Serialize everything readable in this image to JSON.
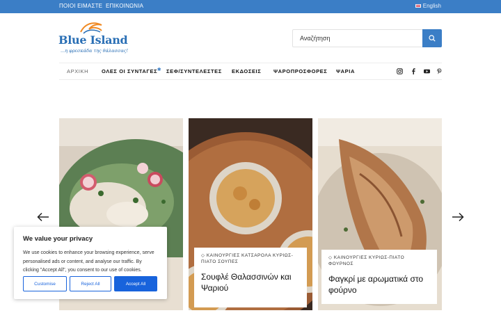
{
  "topbar": {
    "about": "ΠΟΙΟΙ ΕΙΜΑΣΤΕ",
    "contact": "ΕΠΙΚΟΙΝΩΝΙΑ",
    "language": "English"
  },
  "logo": {
    "brand": "Blue Island",
    "tagline": "...η φρεσκάδα της θάλασσας!"
  },
  "search": {
    "placeholder": "Αναζήτηση"
  },
  "nav": {
    "items": [
      "ΑΡΧΙΚΗ",
      "ΟΛΕΣ ΟΙ ΣΥΝΤΑΓΕΣ",
      "ΣΕΦ/ΣΥΝΤΕΛΕΣΤΕΣ",
      "ΕΚΔΟΣΕΙΣ",
      "ΨΑΡΟΠΡΟΣΦΟΡΕΣ",
      "ΨΑΡΙΑ"
    ],
    "social_icons": [
      "instagram-icon",
      "facebook-icon",
      "youtube-icon",
      "pinterest-icon"
    ]
  },
  "cards": [
    {
      "categories": "",
      "title": ""
    },
    {
      "categories": "ΚΑΙΝΟΥΡΓΙΕΣ ΚΑΤΣΑΡΟΛΑ ΚΥΡΙΩΣ-ΠΙΑΤΟ ΣΟΥΠΕΣ",
      "title": "Σουφλέ Θαλασσινών και Ψαριού"
    },
    {
      "categories": "ΚΑΙΝΟΥΡΓΙΕΣ ΚΥΡΙΩΣ-ΠΙΑΤΟ ΦΟΥΡΝΟΣ",
      "title": "Φαγκρί με αρωματικά στο φούρνο"
    }
  ],
  "cookie": {
    "title": "We value your privacy",
    "text": "We use cookies to enhance your browsing experience, serve personalised ads or content, and analyse our traffic. By clicking \"Accept All\", you consent to our use of cookies.",
    "customise": "Customise",
    "reject": "Reject All",
    "accept": "Accept All"
  },
  "colors": {
    "brand_blue": "#3b7ec6",
    "cookie_blue": "#1863dc"
  }
}
